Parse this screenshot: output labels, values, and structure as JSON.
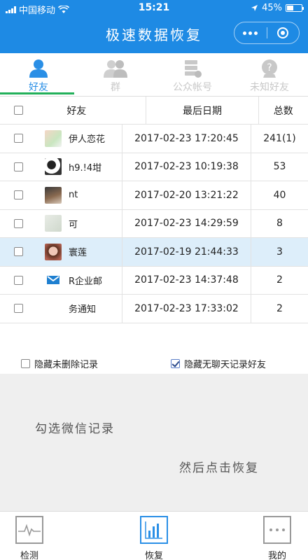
{
  "status_bar": {
    "carrier": "中国移动",
    "time": "15:21",
    "battery": "45%",
    "battery_level": 0.45
  },
  "header": {
    "title": "极速数据恢复"
  },
  "tabs": [
    {
      "label": "好友",
      "icon": "person-icon",
      "active": true
    },
    {
      "label": "群",
      "icon": "group-icon",
      "active": false
    },
    {
      "label": "公众帐号",
      "icon": "official-account-icon",
      "active": false
    },
    {
      "label": "未知好友",
      "icon": "unknown-friend-icon",
      "active": false
    }
  ],
  "table": {
    "headers": {
      "name": "好友",
      "date": "最后日期",
      "total": "总数"
    },
    "rows": [
      {
        "name": "伊人恋花",
        "date": "2017-02-23 17:20:45",
        "total": "241(1)"
      },
      {
        "name": "h9.!4坩",
        "date": "2017-02-23 10:19:38",
        "total": "53"
      },
      {
        "name": "nt",
        "date": "2017-02-20 13:21:22",
        "total": "40"
      },
      {
        "name": "可",
        "date": "2017-02-23 14:29:59",
        "total": "8"
      },
      {
        "name": "寰莲",
        "date": "2017-02-19 21:44:33",
        "total": "3"
      },
      {
        "name": "R企业邮",
        "date": "2017-02-23 14:37:48",
        "total": "2"
      },
      {
        "name": "务通知",
        "date": "2017-02-23 17:33:02",
        "total": "2"
      }
    ]
  },
  "options": {
    "hide_undeleted": "隐藏未删除记录",
    "hide_no_chat": "隐藏无聊天记录好友"
  },
  "hints": {
    "line1": "勾选微信记录",
    "line2": "然后点击恢复"
  },
  "bottom_nav": [
    {
      "label": "检测",
      "icon": "pulse-icon"
    },
    {
      "label": "恢复",
      "icon": "bar-chart-icon"
    },
    {
      "label": "我的",
      "icon": "more-dots-icon"
    }
  ],
  "colors": {
    "primary": "#1e8ae4",
    "tab_active": "#2a8fe6",
    "tab_underline": "#22b05a",
    "selected_row": "#ddeefa",
    "hint_bg": "#efefef"
  }
}
